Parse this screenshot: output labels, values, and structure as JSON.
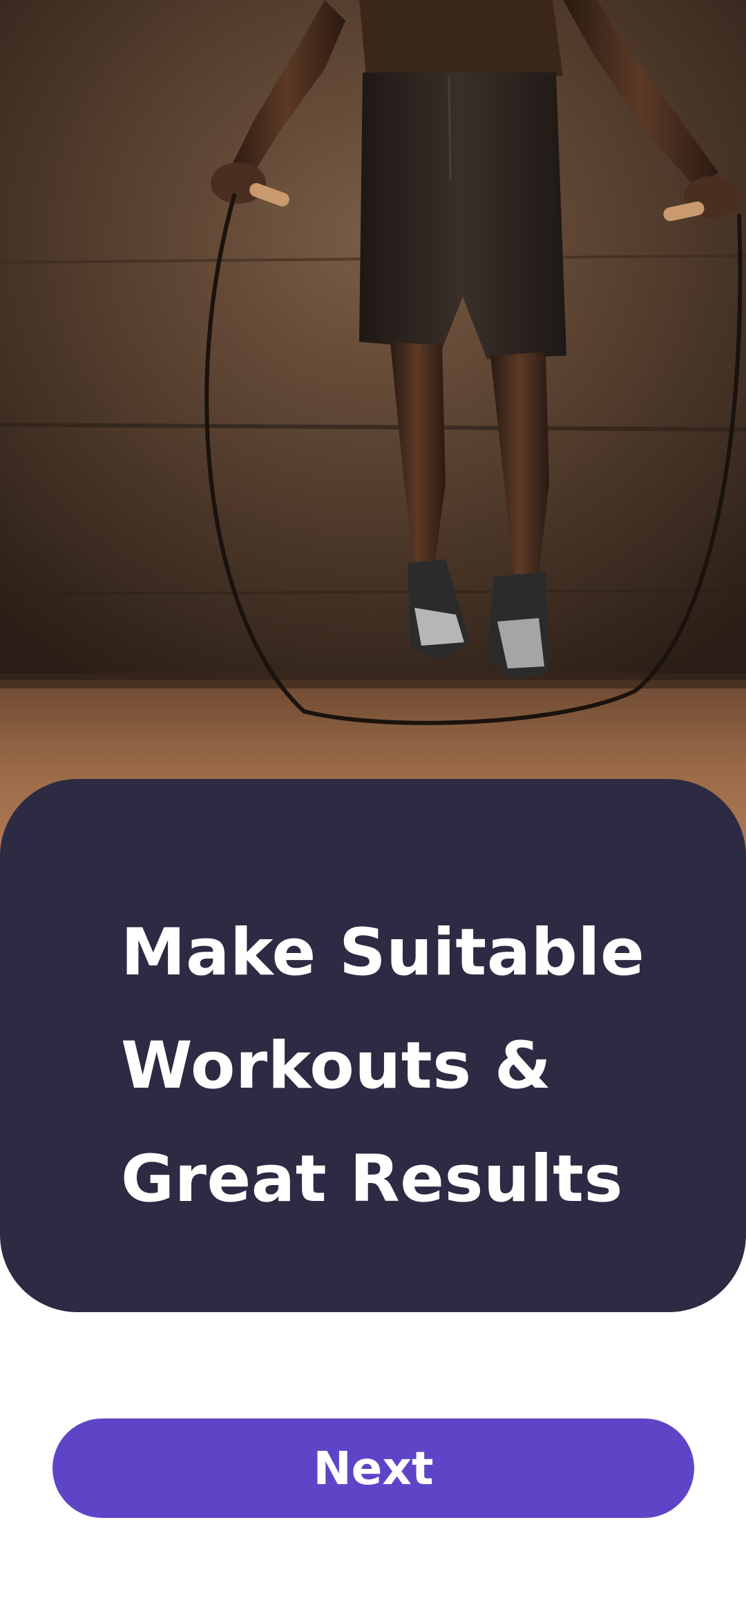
{
  "onboarding": {
    "title_lines": [
      "Make Suitable",
      "Workouts &",
      "Great Results"
    ],
    "next_label": "Next"
  },
  "colors": {
    "card_background": "#2d2a43",
    "primary_button": "#5e45c7",
    "title_text": "#ffffff",
    "page_background": "#ffffff"
  },
  "hero_image": {
    "subject": "person jumping rope on a wooden floor against a dark wall"
  }
}
